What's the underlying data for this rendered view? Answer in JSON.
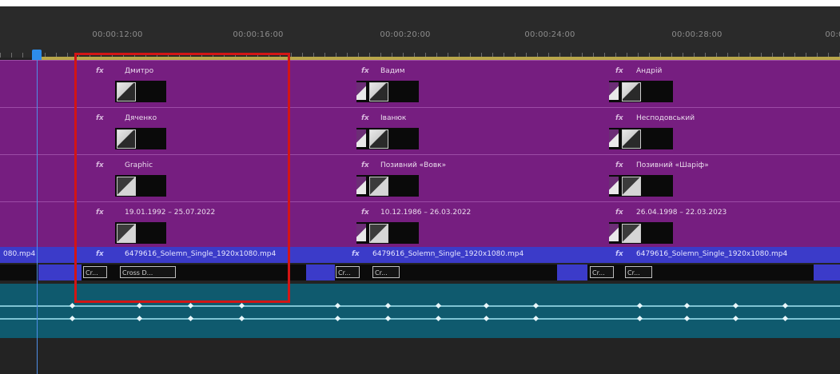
{
  "timeline": {
    "timecodes": [
      "00:00:12:00",
      "00:00:16:00",
      "00:00:20:00",
      "00:00:24:00",
      "00:00:28:00",
      "00:0"
    ],
    "graphic_rows": [
      [
        {
          "fx": "fx",
          "label": "Дмитро"
        },
        {
          "fx": "fx",
          "label": "Вадим"
        },
        {
          "fx": "fx",
          "label": "Андрій"
        }
      ],
      [
        {
          "fx": "fx",
          "label": "Дяченко"
        },
        {
          "fx": "fx",
          "label": "Іванюк"
        },
        {
          "fx": "fx",
          "label": "Несподовський"
        }
      ],
      [
        {
          "fx": "fx",
          "label": "Graphic"
        },
        {
          "fx": "fx",
          "label": "Позивний «Вовк»"
        },
        {
          "fx": "fx",
          "label": "Позивний «Шаріф»"
        }
      ],
      [
        {
          "fx": "fx",
          "label": "19.01.1992 – 25.07.2022"
        },
        {
          "fx": "fx",
          "label": "10.12.1986 – 26.03.2022"
        },
        {
          "fx": "fx",
          "label": "26.04.1998 – 22.03.2023"
        }
      ]
    ],
    "video_track": {
      "left_label": "080.mp4",
      "clips": [
        {
          "fx": "fx",
          "label": "6479616_Solemn_Single_1920x1080.mp4"
        },
        {
          "fx": "fx",
          "label": "6479616_Solemn_Single_1920x1080.mp4"
        },
        {
          "fx": "fx",
          "label": "6479616_Solemn_Single_1920x1080.mp4"
        }
      ]
    },
    "transitions": [
      {
        "a": "Cr...",
        "b": "Cross D..."
      },
      {
        "a": "Cr...",
        "b": "Cr..."
      },
      {
        "a": "Cr...",
        "b": "Cr..."
      }
    ]
  },
  "colors": {
    "graphic_track": "#761e80",
    "video_track": "#3b3bc9",
    "audio_track": "#0f5a6e",
    "playhead": "#2d8ceb",
    "highlight": "#d31515"
  }
}
